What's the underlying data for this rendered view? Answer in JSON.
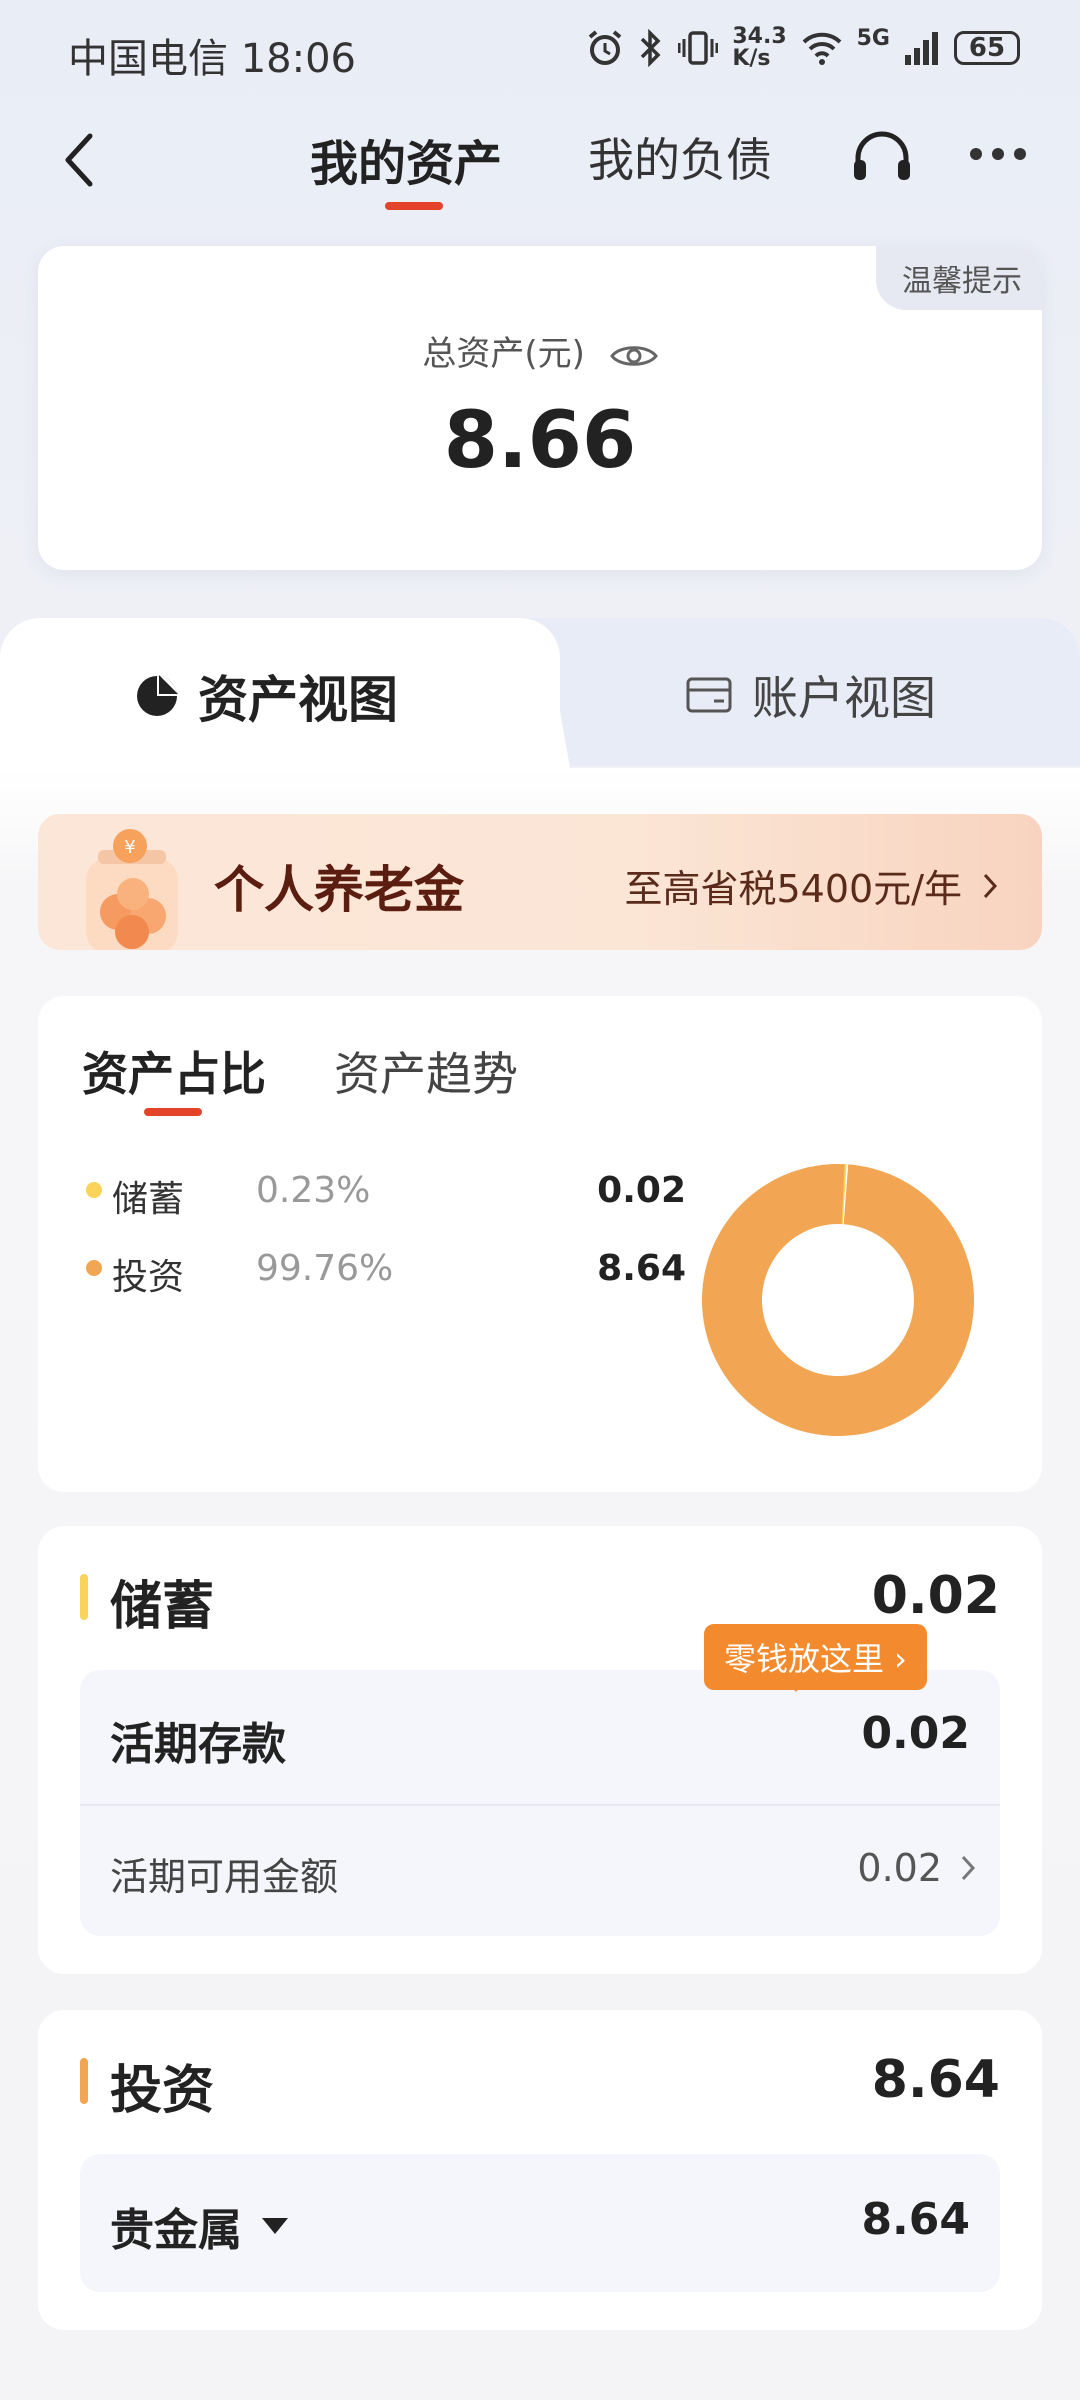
{
  "status_bar": {
    "carrier_time": "中国电信 18:06",
    "speed_value": "34.3",
    "speed_unit": "K/s",
    "network": "5G",
    "battery": "65"
  },
  "nav": {
    "tab_assets": "我的资产",
    "tab_liabilities": "我的负债"
  },
  "total": {
    "tip": "温馨提示",
    "label": "总资产(元)",
    "value": "8.66"
  },
  "view_tabs": {
    "asset_view": "资产视图",
    "account_view": "账户视图"
  },
  "banner": {
    "title": "个人养老金",
    "subtitle": "至高省税5400元/年"
  },
  "allocation": {
    "tab_ratio": "资产占比",
    "tab_trend": "资产趋势",
    "legend": [
      {
        "name": "储蓄",
        "pct": "0.23%",
        "value": "0.02",
        "color": "#f9d35a"
      },
      {
        "name": "投资",
        "pct": "99.76%",
        "value": "8.64",
        "color": "#f2a553"
      }
    ]
  },
  "chart_data": {
    "type": "pie",
    "labels": [
      "储蓄",
      "投资"
    ],
    "values": [
      0.23,
      99.76
    ],
    "colors": [
      "#f9d35a",
      "#f2a553"
    ]
  },
  "savings": {
    "title": "储蓄",
    "total": "0.02",
    "bubble": "零钱放这里 ›",
    "demand_deposit_label": "活期存款",
    "demand_deposit_value": "0.02",
    "available_label": "活期可用金额",
    "available_value": "0.02",
    "accent": "#f9d35a"
  },
  "investment": {
    "title": "投资",
    "total": "8.64",
    "precious_metal_label": "贵金属",
    "precious_metal_value": "8.64",
    "accent": "#f2a553"
  }
}
